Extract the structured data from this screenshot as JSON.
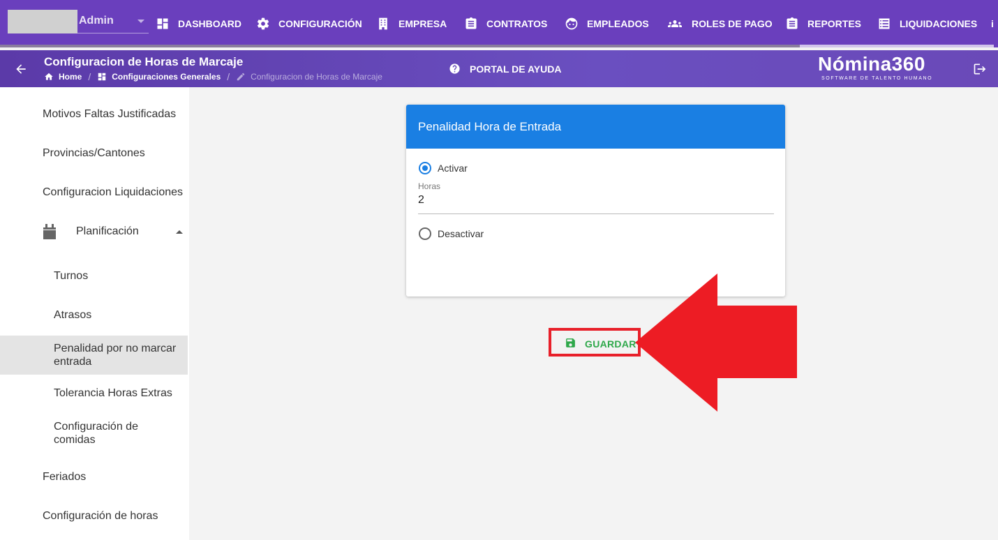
{
  "topnav": {
    "user_name": "Admin",
    "items": [
      {
        "label": "DASHBOARD",
        "icon": "dashboard-icon"
      },
      {
        "label": "CONFIGURACIÓN",
        "icon": "gear-icon"
      },
      {
        "label": "EMPRESA",
        "icon": "building-icon"
      },
      {
        "label": "CONTRATOS",
        "icon": "clipboard-icon"
      },
      {
        "label": "EMPLEADOS",
        "icon": "face-icon"
      },
      {
        "label": "ROLES DE PAGO",
        "icon": "people-icon"
      },
      {
        "label": "REPORTES",
        "icon": "clipboard-icon"
      },
      {
        "label": "LIQUIDACIONES",
        "icon": "list-icon"
      }
    ]
  },
  "header": {
    "title": "Configuracion de Horas de Marcaje",
    "breadcrumb": [
      "Home",
      "Configuraciones Generales",
      "Configuracion de Horas de Marcaje"
    ],
    "help_label": "PORTAL DE AYUDA",
    "brand_name": "Nómina360",
    "brand_tagline": "SOFTWARE DE TALENTO HUMANO"
  },
  "sidebar": {
    "items": [
      {
        "label": "Motivos Faltas Justificadas"
      },
      {
        "label": "Provincias/Cantones"
      },
      {
        "label": "Configuracion Liquidaciones"
      },
      {
        "label": "Planificación",
        "expanded": true
      },
      {
        "label": "Turnos"
      },
      {
        "label": "Atrasos"
      },
      {
        "label": "Penalidad por no marcar entrada",
        "active": true
      },
      {
        "label": "Tolerancia Horas Extras"
      },
      {
        "label": "Configuración de comidas"
      },
      {
        "label": "Feriados"
      },
      {
        "label": "Configuración de horas"
      }
    ]
  },
  "card": {
    "title": "Penalidad Hora de Entrada",
    "option_activate": "Activar",
    "hours_label": "Horas",
    "hours_value": "2",
    "option_deactivate": "Desactivar",
    "selected": "Activar"
  },
  "actions": {
    "save_label": "GUARDAR"
  },
  "colors": {
    "nav_bg": "#6a3fbd",
    "card_header": "#1a7fe3",
    "save_green": "#2ea84a",
    "highlight_red": "#e8202a"
  }
}
